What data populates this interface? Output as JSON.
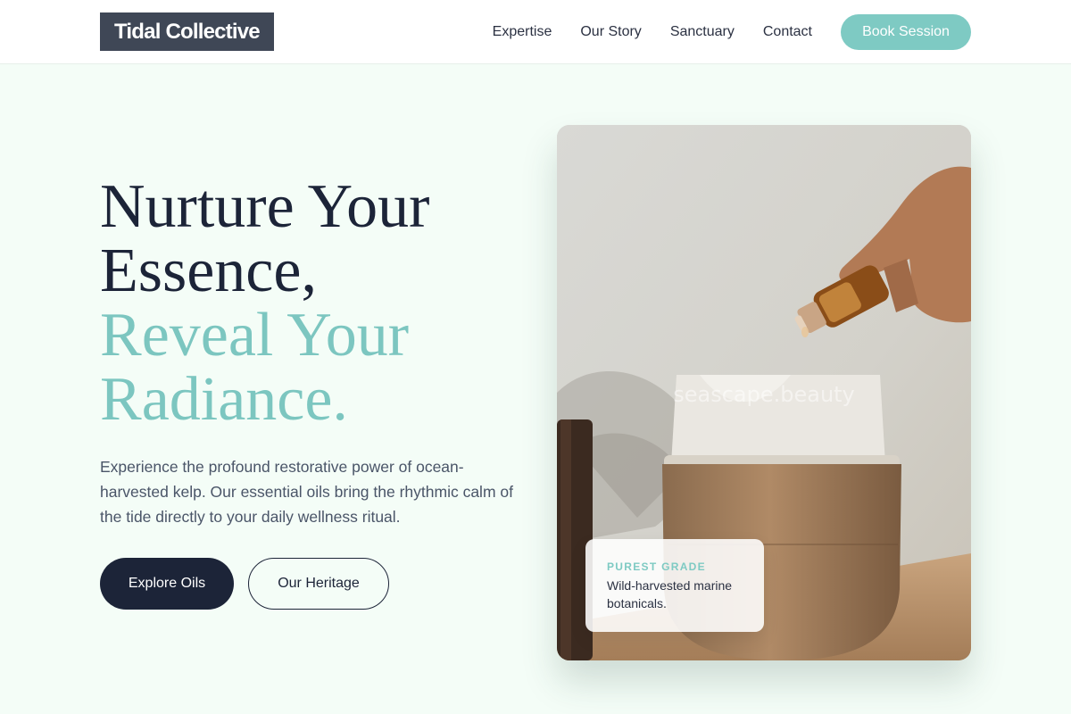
{
  "brand": {
    "name": "Tidal Collective"
  },
  "nav": {
    "links": [
      "Expertise",
      "Our Story",
      "Sanctuary",
      "Contact"
    ],
    "cta": "Book Session"
  },
  "hero": {
    "title_line1": "Nurture Your",
    "title_line2": "Essence,",
    "title_line3": "Reveal Your",
    "title_line4": "Radiance.",
    "description": "Experience the profound restorative power of ocean-harvested kelp. Our essential oils bring the rhythmic calm of the tide directly to your daily wellness ritual.",
    "primary_button": "Explore Oils",
    "secondary_button": "Our Heritage"
  },
  "image": {
    "watermark": "seascape.beauty",
    "badge_label": "PUREST GRADE",
    "badge_text": "Wild-harvested marine botanicals."
  },
  "colors": {
    "accent": "#7ecac3",
    "dark": "#1c2438",
    "background": "#f4fdf7"
  }
}
